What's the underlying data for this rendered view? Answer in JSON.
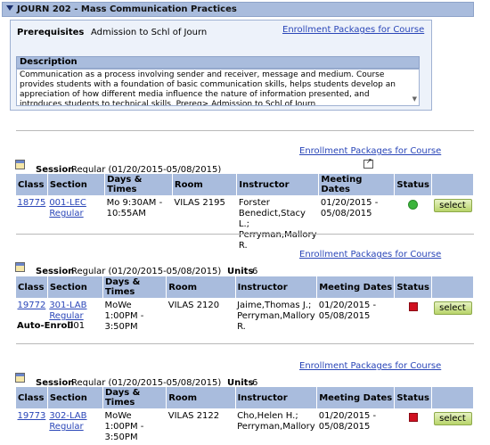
{
  "course": {
    "title": "JOURN 202 - Mass Communication Practices"
  },
  "prereq": {
    "label": "Prerequisites",
    "value": "Admission to Schl of Journ",
    "link": "Enrollment Packages for Course"
  },
  "description": {
    "label": "Description",
    "text": "Communication as a process involving sender and receiver, message and medium. Course provides students with a foundation of basic communication skills, helps students develop an appreciation of how different media influence the nature of information presented, and introduces students to technical skills.  Prereq> Admission to Schl of Journ"
  },
  "headers": [
    "Class",
    "Section",
    "Days & Times",
    "Room",
    "Instructor",
    "Meeting Dates",
    "Status"
  ],
  "select_label": "select",
  "packages": [
    {
      "link": "Enrollment Packages for Course",
      "session_label": "Session",
      "session_value": "Regular (01/20/2015-05/08/2015)",
      "units_label": "",
      "units_value": "",
      "row": {
        "class": "18775",
        "section": "001-LEC",
        "section_type": "Regular",
        "days": "Mo 9:30AM -",
        "times": "10:55AM",
        "room": "VILAS 2195",
        "instructor": [
          "Forster",
          "Benedict,Stacy L.;",
          "Perryman,Mallory R."
        ],
        "dates_start": "01/20/2015 -",
        "dates_end": "05/08/2015",
        "status": "open"
      }
    },
    {
      "link": "Enrollment Packages for Course",
      "session_label": "Session",
      "session_value": "Regular (01/20/2015-05/08/2015)",
      "units_label": "Units",
      "units_value": "6",
      "row": {
        "class": "19772",
        "section": "301-LAB",
        "section_type": "Regular",
        "days": "MoWe 1:00PM -",
        "times": "3:50PM",
        "room": "VILAS 2120",
        "instructor": [
          "Jaime,Thomas J.;",
          "Perryman,Mallory",
          "R."
        ],
        "dates_start": "01/20/2015 -",
        "dates_end": "05/08/2015",
        "status": "closed"
      },
      "auto_enroll_label": "Auto-Enroll",
      "auto_enroll_value": "001"
    },
    {
      "link": "Enrollment Packages for Course",
      "session_label": "Session",
      "session_value": "Regular (01/20/2015-05/08/2015)",
      "units_label": "Units",
      "units_value": "6",
      "row": {
        "class": "19773",
        "section": "302-LAB",
        "section_type": "Regular",
        "days": "MoWe 1:00PM -",
        "times": "3:50PM",
        "room": "VILAS 2122",
        "instructor": [
          "Cho,Helen H.;",
          "Perryman,Mallory"
        ],
        "dates_start": "01/20/2015 -",
        "dates_end": "05/08/2015",
        "status": "closed"
      }
    }
  ]
}
